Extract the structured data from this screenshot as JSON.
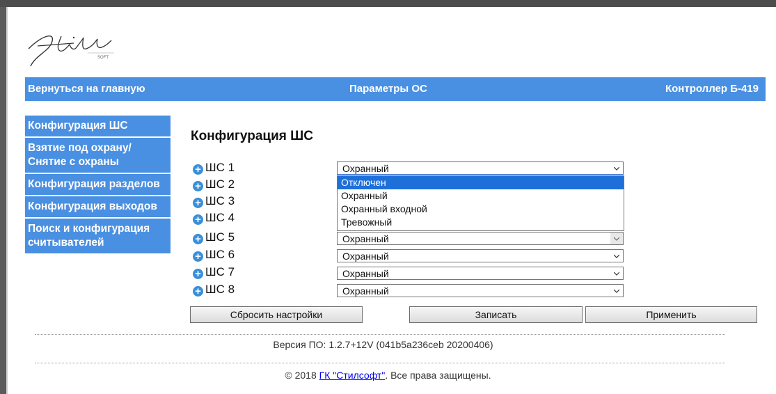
{
  "header": {
    "home_link": "Вернуться на главную",
    "title": "Пара​метры ОС",
    "device": "Контроллер Б-419"
  },
  "sidebar": {
    "items": [
      {
        "label": "Конфигурация ШС"
      },
      {
        "label": "Взятие под охрану/ Снятие с охраны"
      },
      {
        "label": "Конфигурация разделов"
      },
      {
        "label": "Конфигурация выходов"
      },
      {
        "label": "Поиск и конфигурация считывателей"
      }
    ]
  },
  "main": {
    "title": "Конфигурация ШС",
    "zones": [
      {
        "label": "ШС 1",
        "value": "Охранный"
      },
      {
        "label": "ШС 2",
        "value": ""
      },
      {
        "label": "ШС 3",
        "value": ""
      },
      {
        "label": "ШС 4",
        "value": ""
      },
      {
        "label": "ШС 5",
        "value": "Охранный"
      },
      {
        "label": "ШС 6",
        "value": "Охранный"
      },
      {
        "label": "ШС 7",
        "value": "Охранный"
      },
      {
        "label": "ШС 8",
        "value": "Охранный"
      }
    ],
    "dropdown_options": [
      "Отключен",
      "Охранный",
      "Охранный входной",
      "Тревожный"
    ],
    "dropdown_highlighted": "Отключен"
  },
  "buttons": {
    "reset": "Сбросить настройки",
    "write": "Записать",
    "apply": "Применить"
  },
  "footer": {
    "version": "Версия ПО: 1.2.7+12V (041b5a236ceb 20200406)",
    "copyright_prefix": "© 2018 ",
    "company_link": "ГК \"Стилсофт\"",
    "copyright_suffix": ". Все права защищены."
  },
  "icons": {
    "zone_expand": "plus-circle-icon",
    "select_arrow": "chevron-down-icon"
  },
  "colors": {
    "accent": "#4a90e2",
    "selection": "#1e6fd9"
  }
}
